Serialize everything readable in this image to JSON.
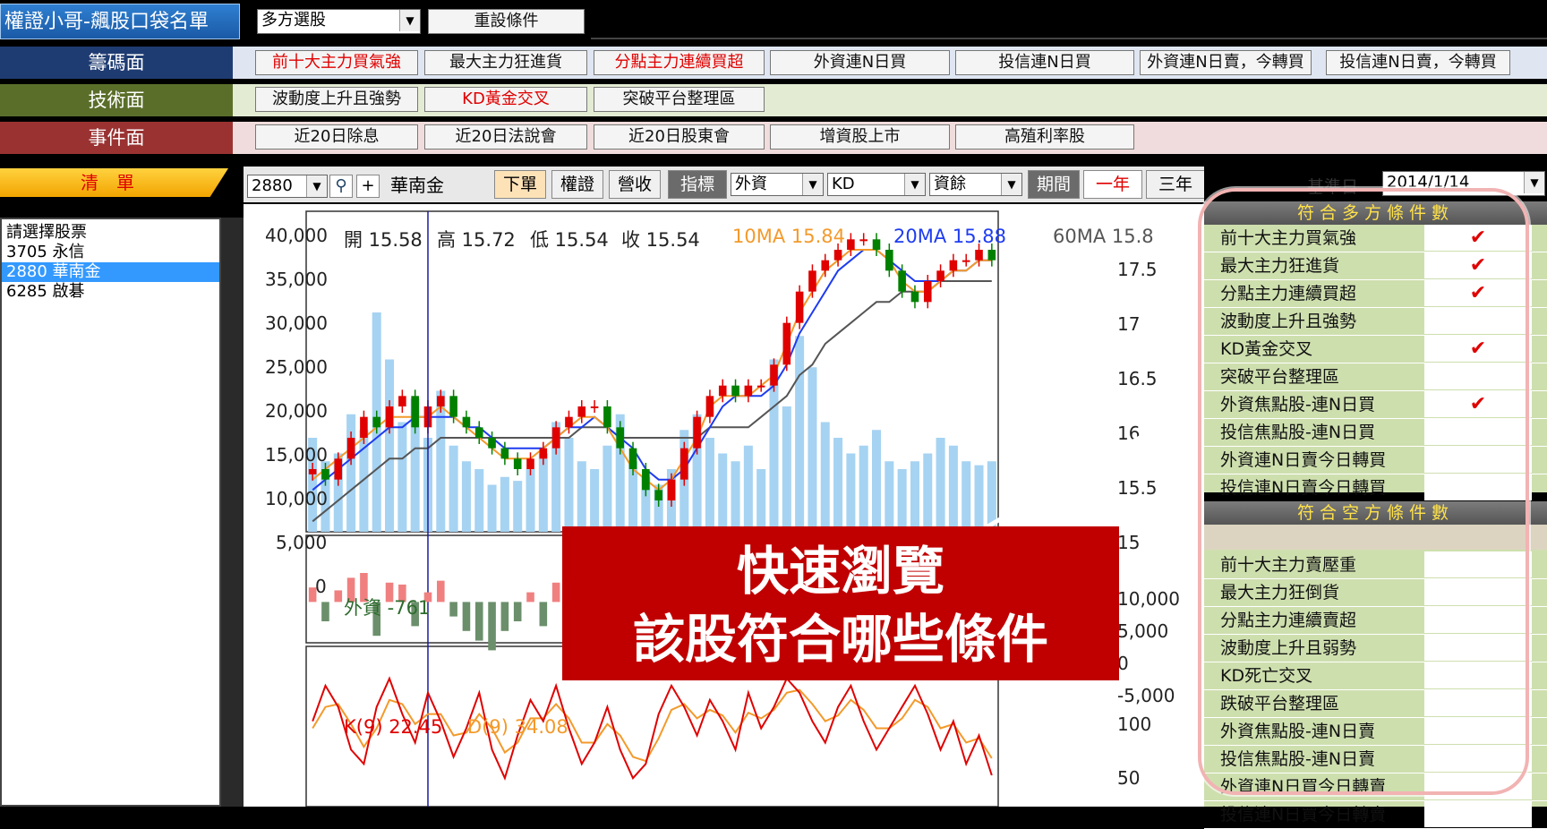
{
  "header": {
    "title": "權證小哥-飆股口袋名單",
    "strategy_select": "多方選股",
    "reset_button": "重設條件"
  },
  "rows": {
    "chip": {
      "label": "籌碼面",
      "buttons": [
        "前十大主力買氣強",
        "最大主力狂進貨",
        "分點主力連續買超",
        "外資連N日買",
        "投信連N日買",
        "外資連N日賣，今轉買",
        "投信連N日賣，今轉買"
      ]
    },
    "tech": {
      "label": "技術面",
      "buttons": [
        "波動度上升且強勢",
        "KD黃金交叉",
        "突破平台整理區"
      ]
    },
    "event": {
      "label": "事件面",
      "buttons": [
        "近20日除息",
        "近20日法說會",
        "近20日股東會",
        "增資股上市",
        "高殖利率股"
      ]
    }
  },
  "list": {
    "tab": "清　單",
    "header": "請選擇股票",
    "items": [
      "3705 永信",
      "2880 華南金",
      "6285 啟碁"
    ],
    "selected_index": 1
  },
  "toolbar": {
    "code_value": "2880",
    "stock_name": "華南金",
    "buttons": [
      "下單",
      "權證",
      "營收"
    ],
    "indicator_label": "指標",
    "indicator_selects": [
      "外資",
      "KD",
      "資餘"
    ],
    "period_label": "期間",
    "period_options": [
      "一年",
      "三年"
    ],
    "base_date_label": "基準日",
    "base_date_value": "2014/1/14"
  },
  "chart_info": {
    "open": "開 15.58",
    "high": "高 15.72",
    "low": "低 15.54",
    "close": "收 15.54",
    "ma10": "10MA 15.84",
    "ma20": "20MA 15.88",
    "ma60": "60MA 15.8",
    "foreign_label": "外資 -761",
    "k_label": "K(9) 22.45",
    "d_label": "D(9) 34.08"
  },
  "chart_data": {
    "type": "candlestick",
    "left_axis_ticks": [
      "40,000",
      "35,000",
      "30,000",
      "25,000",
      "20,000",
      "15,000",
      "10,000",
      "5,000",
      "0"
    ],
    "right_axis_ticks": [
      "17.5",
      "17",
      "16.5",
      "16",
      "15.5",
      "15"
    ],
    "foreign_axis_ticks": [
      "10,000",
      "5,000",
      "0",
      "-5,000"
    ],
    "kd_axis_ticks": [
      "100",
      "50"
    ],
    "price_range": [
      14.7,
      17.7
    ],
    "volume_range": [
      0,
      40000
    ],
    "close_series": [
      15.3,
      15.2,
      15.4,
      15.6,
      15.8,
      15.7,
      15.9,
      16.0,
      15.7,
      15.9,
      16.0,
      15.8,
      15.7,
      15.6,
      15.5,
      15.4,
      15.3,
      15.4,
      15.5,
      15.7,
      15.8,
      15.9,
      15.9,
      15.7,
      15.5,
      15.3,
      15.1,
      15.0,
      15.2,
      15.5,
      15.8,
      16.0,
      16.1,
      16.0,
      16.1,
      16.1,
      16.3,
      16.7,
      17.0,
      17.2,
      17.3,
      17.4,
      17.5,
      17.5,
      17.4,
      17.2,
      17.0,
      16.9,
      17.1,
      17.2,
      17.3,
      17.3,
      17.4,
      17.3
    ],
    "ma10_series": [
      15.2,
      15.3,
      15.4,
      15.5,
      15.6,
      15.7,
      15.8,
      15.8,
      15.8,
      15.8,
      15.9,
      15.8,
      15.7,
      15.6,
      15.5,
      15.4,
      15.4,
      15.4,
      15.5,
      15.6,
      15.7,
      15.8,
      15.8,
      15.7,
      15.5,
      15.3,
      15.2,
      15.1,
      15.2,
      15.4,
      15.6,
      15.9,
      16.0,
      16.0,
      16.0,
      16.1,
      16.2,
      16.5,
      16.8,
      17.0,
      17.2,
      17.3,
      17.4,
      17.4,
      17.4,
      17.3,
      17.1,
      17.0,
      17.0,
      17.1,
      17.2,
      17.2,
      17.3,
      17.3
    ],
    "ma20_series": [
      15.1,
      15.2,
      15.3,
      15.4,
      15.5,
      15.6,
      15.7,
      15.7,
      15.8,
      15.8,
      15.8,
      15.8,
      15.7,
      15.7,
      15.6,
      15.5,
      15.5,
      15.5,
      15.5,
      15.6,
      15.7,
      15.7,
      15.8,
      15.7,
      15.6,
      15.5,
      15.3,
      15.2,
      15.2,
      15.3,
      15.5,
      15.7,
      15.9,
      16.0,
      16.0,
      16.0,
      16.1,
      16.3,
      16.6,
      16.8,
      17.0,
      17.2,
      17.3,
      17.4,
      17.4,
      17.3,
      17.2,
      17.1,
      17.1,
      17.1,
      17.2,
      17.2,
      17.3,
      17.3
    ],
    "ma60_series": [
      14.8,
      14.9,
      15.0,
      15.1,
      15.2,
      15.3,
      15.4,
      15.4,
      15.5,
      15.5,
      15.6,
      15.6,
      15.6,
      15.6,
      15.6,
      15.6,
      15.6,
      15.6,
      15.6,
      15.6,
      15.6,
      15.7,
      15.7,
      15.7,
      15.6,
      15.6,
      15.6,
      15.6,
      15.6,
      15.6,
      15.6,
      15.7,
      15.7,
      15.7,
      15.7,
      15.8,
      15.9,
      16.0,
      16.2,
      16.3,
      16.5,
      16.6,
      16.7,
      16.8,
      16.9,
      16.9,
      17.0,
      17.0,
      17.0,
      17.1,
      17.1,
      17.1,
      17.1,
      17.1
    ],
    "volume_series": [
      12000,
      9000,
      10000,
      15000,
      13000,
      28000,
      22000,
      14000,
      17000,
      12000,
      18000,
      11000,
      9000,
      8000,
      6000,
      7000,
      6500,
      8000,
      10000,
      14000,
      12000,
      9000,
      8000,
      11000,
      15000,
      9000,
      7000,
      6000,
      8000,
      13000,
      15000,
      12000,
      10000,
      9000,
      11000,
      8000,
      22000,
      16000,
      25000,
      21000,
      14000,
      12000,
      10000,
      11000,
      13000,
      9000,
      8000,
      9000,
      10000,
      12000,
      11000,
      9000,
      8500,
      9000
    ],
    "foreign_series": [
      1500,
      -2000,
      1200,
      2500,
      3000,
      -3500,
      2000,
      1800,
      -2500,
      1000,
      2200,
      -1500,
      -3000,
      -4000,
      -5000,
      -3000,
      -2000,
      1000,
      -2500,
      2000,
      1500,
      -1000,
      -2500,
      -3000,
      -3500,
      -5000,
      -4500,
      -2000,
      1500,
      2500,
      2000,
      -1800,
      1200,
      1000,
      -1500,
      1000,
      3000,
      2500,
      3500,
      2000,
      1500,
      -2000,
      1800,
      2200,
      -3000,
      -3500,
      -2000,
      1500,
      2000,
      1800,
      -1500,
      1200,
      1000,
      -800
    ],
    "k_series": [
      60,
      85,
      70,
      40,
      30,
      70,
      90,
      65,
      45,
      80,
      60,
      35,
      55,
      80,
      40,
      20,
      50,
      75,
      60,
      85,
      55,
      30,
      45,
      70,
      40,
      20,
      30,
      65,
      85,
      70,
      50,
      75,
      60,
      40,
      80,
      55,
      70,
      90,
      80,
      60,
      45,
      70,
      85,
      60,
      40,
      55,
      70,
      85,
      65,
      40,
      60,
      30,
      50,
      22
    ],
    "d_series": [
      55,
      70,
      72,
      58,
      42,
      55,
      75,
      72,
      58,
      65,
      65,
      50,
      52,
      65,
      55,
      38,
      45,
      62,
      62,
      72,
      62,
      45,
      45,
      58,
      50,
      35,
      32,
      48,
      68,
      72,
      62,
      68,
      64,
      52,
      66,
      62,
      68,
      80,
      82,
      72,
      60,
      64,
      75,
      68,
      55,
      55,
      62,
      75,
      70,
      55,
      58,
      45,
      48,
      34
    ],
    "ma10_color": "#f39a2b",
    "ma20_color": "#1e3cf0",
    "ma60_color": "#555555",
    "up_color": "#e00000",
    "down_color": "#008000",
    "volume_color": "#a6d3f2"
  },
  "overlay": {
    "line1": "快速瀏覽",
    "line2": "該股符合哪些條件",
    "bg_color": "#c00000"
  },
  "bull_panel": {
    "title": "符合多方條件數",
    "conditions": [
      {
        "label": "前十大主力買氣強",
        "check": "✔"
      },
      {
        "label": "最大主力狂進貨",
        "check": "✔"
      },
      {
        "label": "分點主力連續買超",
        "check": "✔"
      },
      {
        "label": "波動度上升且強勢",
        "check": ""
      },
      {
        "label": "KD黃金交叉",
        "check": "✔"
      },
      {
        "label": "突破平台整理區",
        "check": ""
      },
      {
        "label": "外資焦點股-連N日買",
        "check": "✔"
      },
      {
        "label": "投信焦點股-連N日買",
        "check": ""
      },
      {
        "label": "外資連N日賣今日轉買",
        "check": ""
      },
      {
        "label": "投信連N日賣今日轉買",
        "check": ""
      }
    ]
  },
  "bear_panel": {
    "title": "符合空方條件數",
    "conditions": [
      {
        "label": "前十大主力賣壓重",
        "check": ""
      },
      {
        "label": "最大主力狂倒貨",
        "check": ""
      },
      {
        "label": "分點主力連續賣超",
        "check": ""
      },
      {
        "label": "波動度上升且弱勢",
        "check": ""
      },
      {
        "label": "KD死亡交叉",
        "check": ""
      },
      {
        "label": "跌破平台整理區",
        "check": ""
      },
      {
        "label": "外資焦點股-連N日賣",
        "check": ""
      },
      {
        "label": "投信焦點股-連N日賣",
        "check": ""
      },
      {
        "label": "外資連N日買今日轉賣",
        "check": ""
      },
      {
        "label": "投信連N日買今日轉賣",
        "check": ""
      }
    ]
  }
}
